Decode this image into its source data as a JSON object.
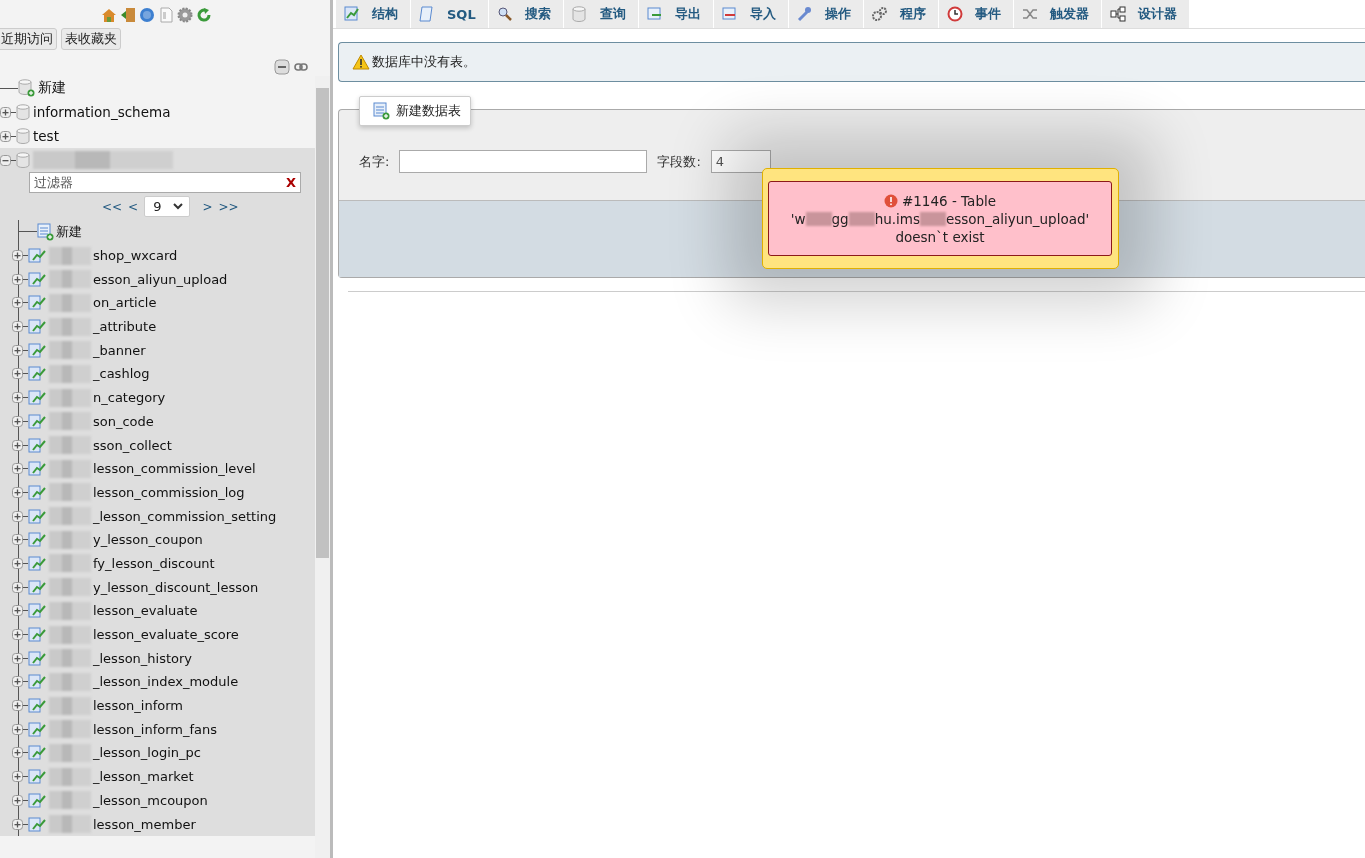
{
  "nav_buttons": [
    {
      "label": "近期访问"
    },
    {
      "label": "表收藏夹"
    }
  ],
  "tree": {
    "items": [
      {
        "kind": "new",
        "label": "新建"
      },
      {
        "kind": "db",
        "label": "information_schema",
        "expanded": false
      },
      {
        "kind": "db",
        "label": "test",
        "expanded": false
      },
      {
        "kind": "db",
        "expanded": true,
        "filter": {
          "placeholder": "过滤器",
          "clear": "X"
        },
        "pager": {
          "first": "<<",
          "prev": "<",
          "page": "9",
          "next": ">",
          "last": ">>"
        },
        "children": [
          {
            "kind": "new",
            "label": "新建"
          },
          {
            "kind": "table",
            "label": "shop_wxcard",
            "expanded": false
          },
          {
            "kind": "table",
            "label": "esson_aliyun_upload",
            "expanded": false
          },
          {
            "kind": "table",
            "label": "on_article",
            "expanded": false
          },
          {
            "kind": "table",
            "label": "_attribute",
            "expanded": false
          },
          {
            "kind": "table",
            "label": "_banner",
            "expanded": false
          },
          {
            "kind": "table",
            "label": "_cashlog",
            "expanded": false
          },
          {
            "kind": "table",
            "label": "n_category",
            "expanded": false
          },
          {
            "kind": "table",
            "label": "son_code",
            "expanded": false
          },
          {
            "kind": "table",
            "label": "sson_collect",
            "expanded": false
          },
          {
            "kind": "table",
            "label": "lesson_commission_level",
            "expanded": false
          },
          {
            "kind": "table",
            "label": "lesson_commission_log",
            "expanded": false
          },
          {
            "kind": "table",
            "label": "_lesson_commission_setting",
            "expanded": false
          },
          {
            "kind": "table",
            "label": "y_lesson_coupon",
            "expanded": false
          },
          {
            "kind": "table",
            "label": "fy_lesson_discount",
            "expanded": false
          },
          {
            "kind": "table",
            "label": "y_lesson_discount_lesson",
            "expanded": false
          },
          {
            "kind": "table",
            "label": "lesson_evaluate",
            "expanded": false
          },
          {
            "kind": "table",
            "label": "lesson_evaluate_score",
            "expanded": false
          },
          {
            "kind": "table",
            "label": "_lesson_history",
            "expanded": false
          },
          {
            "kind": "table",
            "label": "_lesson_index_module",
            "expanded": false
          },
          {
            "kind": "table",
            "label": "lesson_inform",
            "expanded": false
          },
          {
            "kind": "table",
            "label": "lesson_inform_fans",
            "expanded": false
          },
          {
            "kind": "table",
            "label": "_lesson_login_pc",
            "expanded": false
          },
          {
            "kind": "table",
            "label": "_lesson_market",
            "expanded": false
          },
          {
            "kind": "table",
            "label": "_lesson_mcoupon",
            "expanded": false
          },
          {
            "kind": "table",
            "label": "lesson_member",
            "expanded": false
          }
        ]
      }
    ]
  },
  "tabs": [
    {
      "kind": "structure",
      "label": "结构",
      "selected": false
    },
    {
      "kind": "sql",
      "label": "SQL",
      "selected": false
    },
    {
      "kind": "search",
      "label": "搜索",
      "selected": false
    },
    {
      "kind": "query",
      "label": "查询",
      "selected": false
    },
    {
      "kind": "export",
      "label": "导出",
      "selected": false
    },
    {
      "kind": "import",
      "label": "导入",
      "selected": false
    },
    {
      "kind": "operations",
      "label": "操作",
      "selected": false
    },
    {
      "kind": "routines",
      "label": "程序",
      "selected": false
    },
    {
      "kind": "events",
      "label": "事件",
      "selected": false
    },
    {
      "kind": "triggers",
      "label": "触发器",
      "selected": false
    },
    {
      "kind": "designer",
      "label": "设计器",
      "selected": false
    }
  ],
  "notice": {
    "kind": "warning",
    "text": "数据库中没有表。"
  },
  "create_table": {
    "legend": "新建数据表",
    "name_label": "名字:",
    "columns_label": "字段数:",
    "columns_value": "4"
  },
  "error": {
    "code_line": "#1146 - Table",
    "table_ref_parts": [
      "'w",
      "gg",
      "hu.ims",
      "esson_aliyun_upload'"
    ],
    "tail": "doesn`t exist"
  }
}
